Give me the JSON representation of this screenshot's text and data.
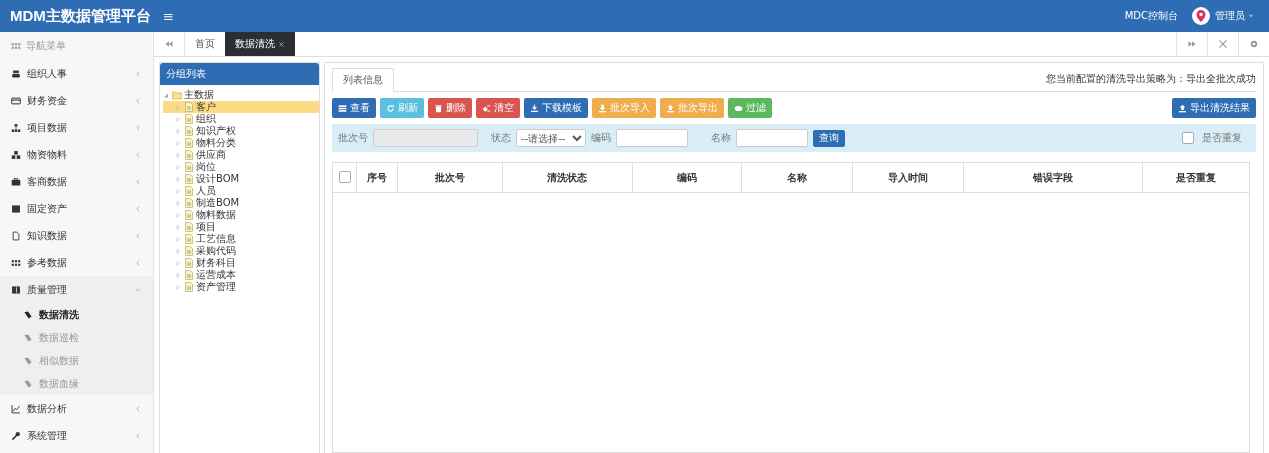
{
  "header": {
    "title": "MDM主数据管理平台",
    "menu_toggle": "≡",
    "console_link": "MDC控制台",
    "user": "管理员"
  },
  "sidebar": {
    "heading": "导航菜单",
    "items": [
      {
        "label": "组织人事",
        "expanded": false
      },
      {
        "label": "财务资金",
        "expanded": false
      },
      {
        "label": "项目数据",
        "expanded": false
      },
      {
        "label": "物资物料",
        "expanded": false
      },
      {
        "label": "客商数据",
        "expanded": false
      },
      {
        "label": "固定资产",
        "expanded": false
      },
      {
        "label": "知识数据",
        "expanded": false
      },
      {
        "label": "参考数据",
        "expanded": false
      },
      {
        "label": "质量管理",
        "expanded": true,
        "children": [
          {
            "label": "数据清洗",
            "selected": true
          },
          {
            "label": "数据巡检",
            "selected": false
          },
          {
            "label": "相似数据",
            "selected": false
          },
          {
            "label": "数据血缘",
            "selected": false
          }
        ]
      },
      {
        "label": "数据分析",
        "expanded": false
      },
      {
        "label": "系统管理",
        "expanded": false
      }
    ]
  },
  "page_tabs": [
    {
      "label": "首页",
      "selected": false,
      "closable": false
    },
    {
      "label": "数据清洗",
      "selected": true,
      "closable": true
    }
  ],
  "tree_panel": {
    "title": "分组列表",
    "root": {
      "label": "主数据",
      "expanded": true,
      "children": [
        {
          "label": "客户",
          "selected": true
        },
        {
          "label": "组织",
          "selected": false
        },
        {
          "label": "知识产权",
          "selected": false
        },
        {
          "label": "物料分类",
          "selected": false
        },
        {
          "label": "供应商",
          "selected": false
        },
        {
          "label": "岗位",
          "selected": false
        },
        {
          "label": "设计BOM",
          "selected": false
        },
        {
          "label": "人员",
          "selected": false
        },
        {
          "label": "制造BOM",
          "selected": false
        },
        {
          "label": "物料数据",
          "selected": false
        },
        {
          "label": "项目",
          "selected": false
        },
        {
          "label": "工艺信息",
          "selected": false
        },
        {
          "label": "采购代码",
          "selected": false
        },
        {
          "label": "财务科目",
          "selected": false
        },
        {
          "label": "运营成本",
          "selected": false
        },
        {
          "label": "资产管理",
          "selected": false
        }
      ]
    }
  },
  "main": {
    "tab": "列表信息",
    "policy_text": "您当前配置的清洗导出策略为：导出全批次成功",
    "toolbar": [
      {
        "label": "查看",
        "kind": "primary"
      },
      {
        "label": "刷新",
        "kind": "info"
      },
      {
        "label": "删除",
        "kind": "danger"
      },
      {
        "label": "清空",
        "kind": "danger"
      },
      {
        "label": "下载模板",
        "kind": "primary"
      },
      {
        "label": "批次导入",
        "kind": "warning"
      },
      {
        "label": "批次导出",
        "kind": "warning"
      },
      {
        "label": "过滤",
        "kind": "success"
      }
    ],
    "export_button": "导出清洗结果",
    "filters": {
      "batch_label": "批次号",
      "status_label": "状态",
      "status_value": "--请选择--",
      "code_label": "编码",
      "name_label": "名称",
      "query_button": "查询",
      "duplicate_label": "是否重复",
      "duplicate_checked": false
    },
    "table": {
      "columns": [
        "序号",
        "批次号",
        "清洗状态",
        "编码",
        "名称",
        "导入时间",
        "错误字段",
        "是否重复"
      ],
      "all_checked": false
    }
  }
}
